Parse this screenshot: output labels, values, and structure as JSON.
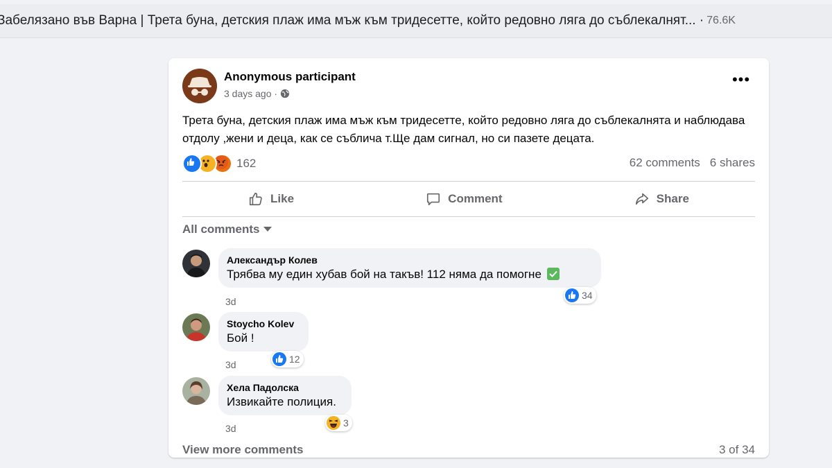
{
  "header": {
    "title": "Забелязано във Варна | Трета буна, детския плаж има мъж към тридесетте, който редовно ляга до съблекалнят... ·",
    "count": "76.6K"
  },
  "post": {
    "author": "Anonymous participant",
    "time": "3 days ago ·",
    "privacy_icon": "globe-icon",
    "menu_label": "•••",
    "text": "Трета буна, детския плаж има мъж към тридесетте, който редовно ляга до съблекалнята и наблюдава отдолу ,жени и деца, как се съблича т.Ще дам сигнал, но си пазете децата.",
    "reactions": {
      "icons": [
        "like-icon",
        "wow-icon",
        "angry-icon"
      ],
      "count": "162"
    },
    "comments_count": "62 comments",
    "shares_count": "6 shares"
  },
  "actions": {
    "like": "Like",
    "comment": "Comment",
    "share": "Share"
  },
  "comments_filter": "All comments",
  "comments": [
    {
      "name": "Александър Колев",
      "text": "Трябва му един хубав бой на такъв! 112 няма да помогне",
      "emoji": "check-mark-icon",
      "reaction_icon": "like-icon",
      "reaction_count": "34",
      "time": "3d"
    },
    {
      "name": "Stoycho Kolev",
      "text": "Бой !",
      "reaction_icon": "like-icon",
      "reaction_count": "12",
      "time": "3d"
    },
    {
      "name": "Хела Падолска",
      "text": "Извикайте полиция.",
      "reaction_icon": "haha-icon",
      "reaction_count": "3",
      "time": "3d"
    }
  ],
  "footer": {
    "view_more": "View more comments",
    "pagination": "3 of 34"
  },
  "colors": {
    "background": "#f0f2f5",
    "card": "#ffffff",
    "secondary_text": "#65676b",
    "like_blue": "#1877f2"
  }
}
